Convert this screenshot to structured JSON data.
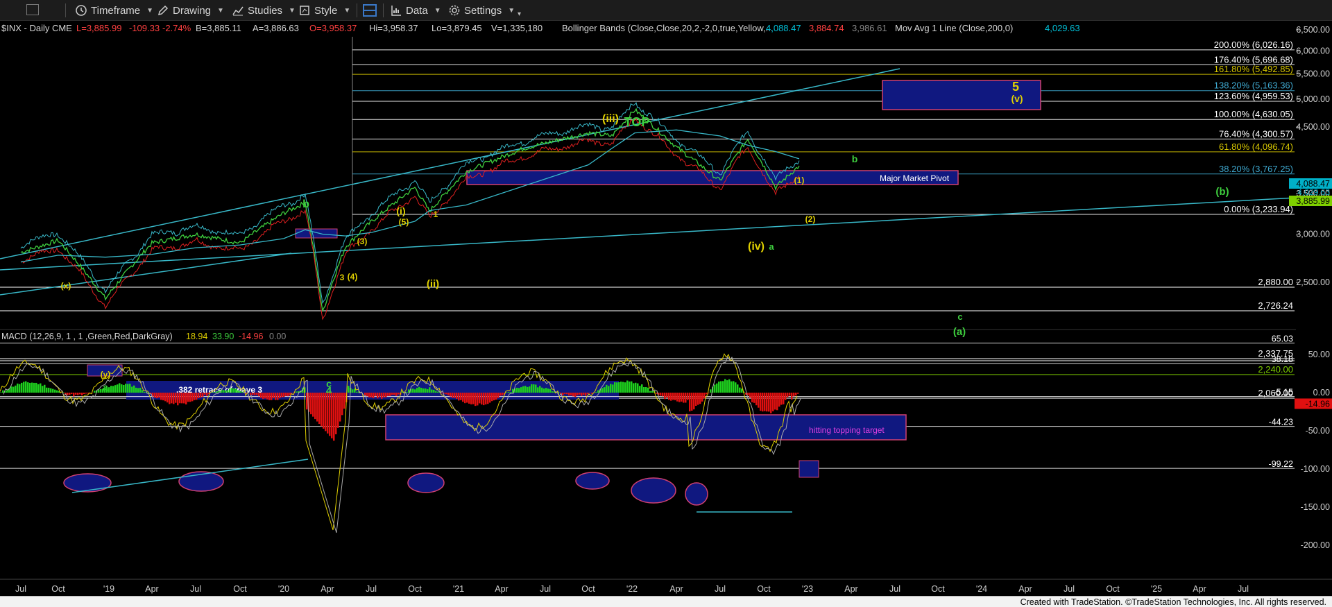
{
  "toolbar": {
    "timeframe_label": "Timeframe",
    "drawing_label": "Drawing",
    "studies_label": "Studies",
    "style_label": "Style",
    "data_label": "Data",
    "settings_label": "Settings",
    "colors": {
      "bg": "#1c1c1c",
      "text": "#d6d6d6",
      "accent": "#3a78c8"
    }
  },
  "header": {
    "symbol": "$INX - Daily  CME",
    "last": "L=3,885.99",
    "change": "-109.33",
    "change_pct": "-2.74%",
    "bid": "B=3,885.11",
    "ask": "A=3,886.63",
    "open": "O=3,958.37",
    "high": "Hi=3,958.37",
    "low": "Lo=3,879.45",
    "volume": "V=1,335,180",
    "bb_label": "Bollinger Bands (Close,Close,20,2,-2,0,true,Yellow,...",
    "bb_upper": "4,088.47",
    "bb_lower": "3,884.74",
    "bb_mid": "3,986.61",
    "ma_label": "Mov Avg 1 Line (Close,200,0)",
    "ma_value": "4,029.63"
  },
  "price_axis": {
    "ticks": [
      "6,500.00",
      "6,000.00",
      "5,500.00",
      "5,000.00",
      "4,500.00",
      "3,500.00",
      "3,000.00",
      "2,500.00"
    ],
    "badges": [
      {
        "text": "4,088.47",
        "color": "#00b0c8"
      },
      {
        "text": "3,885.99",
        "color": "#7fd000"
      }
    ],
    "extra_label": "4,029.63"
  },
  "fib_levels": [
    {
      "label": "200.00% (6,026.16)",
      "price": 6026.16,
      "color": "#ffffff"
    },
    {
      "label": "176.40% (5,696.68)",
      "price": 5696.68,
      "color": "#ffffff"
    },
    {
      "label": "161.80% (5,492.85)",
      "price": 5492.85,
      "color": "#d8c800"
    },
    {
      "label": "138.20% (5,163.36)",
      "price": 5163.36,
      "color": "#3fa9d0"
    },
    {
      "label": "123.60% (4,959.53)",
      "price": 4959.53,
      "color": "#ffffff"
    },
    {
      "label": "100.00% (4,630.05)",
      "price": 4630.05,
      "color": "#ffffff"
    },
    {
      "label": "76.40% (4,300.57)",
      "price": 4300.57,
      "color": "#ffffff"
    },
    {
      "label": "61.80% (4,096.74)",
      "price": 4096.74,
      "color": "#d8c800"
    },
    {
      "label": "38.20% (3,767.25)",
      "price": 3767.25,
      "color": "#3fa9d0"
    },
    {
      "label": "0.00% (3,233.94)",
      "price": 3233.94,
      "color": "#ffffff"
    }
  ],
  "support_levels": [
    {
      "label": "2,880.00",
      "price": 2880,
      "color": "#ffffff"
    },
    {
      "label": "2,726.24",
      "price": 2726.24,
      "color": "#ffffff"
    },
    {
      "label": "2,337.75",
      "price": 2337.75,
      "color": "#ffffff"
    },
    {
      "label": "2,330.00",
      "price": 2330,
      "color": "#ffffff"
    },
    {
      "label": "2,240.00",
      "price": 2240,
      "color": "#7fd000"
    },
    {
      "label": "2,060.00",
      "price": 2060,
      "color": "#ffffff"
    }
  ],
  "zones": {
    "major_pivot_label": "Major Market Pivot",
    "retrace_label": ".382 retrace of wave 3",
    "topping_label": "hitting topping target"
  },
  "wave_labels": [
    {
      "text": "(iii)",
      "color": "#e0d000"
    },
    {
      "text": "TOP",
      "color": "#3ecf3e"
    },
    {
      "text": "5",
      "color": "#e0d000"
    },
    {
      "text": "(v)",
      "color": "#e0d000"
    },
    {
      "text": "(i)",
      "color": "#e0d000"
    },
    {
      "text": "(ii)",
      "color": "#e0d000"
    },
    {
      "text": "(iv)",
      "color": "#e0d000"
    },
    {
      "text": "(b)",
      "color": "#3ecf3e"
    },
    {
      "text": "(a)",
      "color": "#3ecf3e"
    },
    {
      "text": "b",
      "color": "#3ecf3e"
    },
    {
      "text": "a",
      "color": "#3ecf3e"
    },
    {
      "text": "c",
      "color": "#3ecf3e"
    },
    {
      "text": "4",
      "color": "#3ecf3e"
    },
    {
      "text": "(x)",
      "color": "#e0d000"
    },
    {
      "text": "(y)",
      "color": "#e0d000"
    },
    {
      "text": "(1)",
      "color": "#e0d000"
    },
    {
      "text": "(2)",
      "color": "#e0d000"
    },
    {
      "text": "(3)",
      "color": "#e0d000"
    },
    {
      "text": "(4)",
      "color": "#e0d000"
    },
    {
      "text": "(5)",
      "color": "#e0d000"
    },
    {
      "text": "1",
      "color": "#e0d000"
    },
    {
      "text": "3",
      "color": "#e0d000"
    }
  ],
  "macd": {
    "label": "MACD (12,26,9, 1 , 1 ,Green,Red,DarkGray)",
    "v1": "18.94",
    "v2": "33.90",
    "v3": "-14.96",
    "v4": "0.00",
    "ticks": [
      "50.00",
      "0.00",
      "-50.00",
      "-100.00",
      "-150.00",
      "-200.00"
    ],
    "level_labels": [
      "65.03",
      "38.18",
      "-5.15",
      "-44.23",
      "-99.22"
    ],
    "current_badge": "-14.96"
  },
  "time_axis": {
    "labels": [
      "Jul",
      "Oct",
      "'19",
      "Apr",
      "Jul",
      "Oct",
      "'20",
      "Apr",
      "Jul",
      "Oct",
      "'21",
      "Apr",
      "Jul",
      "Oct",
      "'22",
      "Apr",
      "Jul",
      "Oct",
      "'23",
      "Apr",
      "Jul",
      "Oct",
      "'24",
      "Apr",
      "Jul",
      "Oct",
      "'25",
      "Apr",
      "Jul"
    ]
  },
  "footer": {
    "text": "Created with TradeStation. ©TradeStation Technologies, Inc. All rights reserved."
  },
  "chart_data": {
    "type": "line",
    "title": "$INX - Daily",
    "ylim": [
      2000,
      6600
    ],
    "x": [
      "Jul 2018",
      "Oct 2018",
      "Dec 2018",
      "Apr 2019",
      "Jul 2019",
      "Oct 2019",
      "Jan 2020",
      "Feb 2020",
      "Mar 2020",
      "Apr 2020",
      "Jun 2020",
      "Sep 2020",
      "Oct 2020",
      "Jan 2021",
      "Apr 2021",
      "Jul 2021",
      "Oct 2021",
      "Jan 2022",
      "Mar 2022",
      "Jun 2022",
      "Aug 2022",
      "Oct 2022",
      "Dec 2022"
    ],
    "series": [
      {
        "values": [
          2800,
          2930,
          2350,
          2900,
          3000,
          2900,
          3250,
          3380,
          2230,
          2860,
          3150,
          3580,
          3270,
          3800,
          4150,
          4400,
          4350,
          4800,
          4170,
          3670,
          4300,
          3580,
          3886
        ]
      }
    ],
    "ma200": {
      "values": [
        2700,
        2770,
        2750,
        2780,
        2850,
        2880,
        2950,
        3050,
        3000,
        2980,
        3020,
        3150,
        3280,
        3350,
        3600,
        3900,
        4150,
        4400,
        4450,
        4350,
        4200,
        4100,
        3990
      ]
    }
  }
}
